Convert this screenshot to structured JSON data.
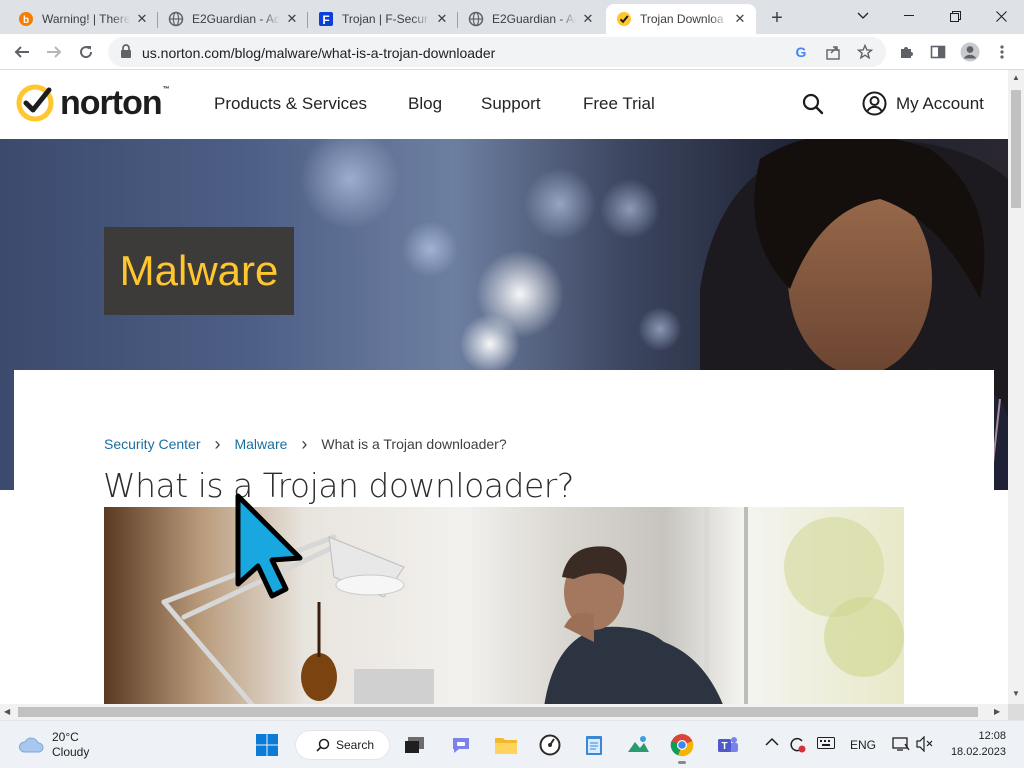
{
  "browser": {
    "tabs": [
      {
        "title": "Warning! | There",
        "favicon": "blogger-icon"
      },
      {
        "title": "E2Guardian - Ac",
        "favicon": "globe-icon"
      },
      {
        "title": "Trojan | F-Secur",
        "favicon": "fsecure-icon"
      },
      {
        "title": "E2Guardian - Ac",
        "favicon": "globe-icon"
      },
      {
        "title": "Trojan Downloa",
        "favicon": "norton-check-icon",
        "active": true
      }
    ],
    "url": "us.norton.com/blog/malware/what-is-a-trojan-downloader"
  },
  "site": {
    "logo_text": "norton",
    "logo_tm": "™",
    "nav": [
      "Products & Services",
      "Blog",
      "Support",
      "Free Trial"
    ],
    "account_label": "My Account",
    "hero_label": "Malware",
    "breadcrumb": [
      "Security Center",
      "Malware",
      "What is a Trojan downloader?"
    ],
    "headline": "What is a Trojan downloader?",
    "brand_color": "#ffc62d",
    "link_color": "#1b6fa0"
  },
  "taskbar": {
    "weather_temp": "20°C",
    "weather_cond": "Cloudy",
    "search_label": "Search",
    "language": "ENG",
    "time": "12:08",
    "date": "18.02.2023"
  }
}
